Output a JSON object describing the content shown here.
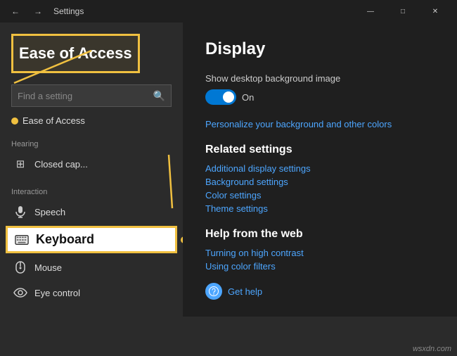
{
  "titleBar": {
    "title": "Settings",
    "backLabel": "←",
    "forwardLabel": "→",
    "minimizeLabel": "—",
    "maximizeLabel": "□",
    "closeLabel": "✕"
  },
  "sidebar": {
    "title": "Ease of Access",
    "search": {
      "placeholder": "Find a setting"
    },
    "breadcrumb": "Ease of Access",
    "sections": [
      {
        "label": "Hearing",
        "items": [
          {
            "id": "closed-captions",
            "text": "Closed cap...",
            "icon": "⊞"
          }
        ]
      },
      {
        "label": "Interaction",
        "items": [
          {
            "id": "speech",
            "text": "Speech",
            "icon": "🎤"
          },
          {
            "id": "keyboard",
            "text": "Keyboard",
            "icon": "⌨"
          },
          {
            "id": "mouse",
            "text": "Mouse",
            "icon": "🖱"
          },
          {
            "id": "eye-control",
            "text": "Eye control",
            "icon": "👁"
          }
        ]
      }
    ]
  },
  "main": {
    "title": "Display",
    "settings": [
      {
        "label": "Show desktop background image",
        "toggle": "on",
        "toggleText": "On"
      }
    ],
    "backgroundLink": "Personalize your background and other colors",
    "relatedSettings": {
      "heading": "Related settings",
      "links": [
        "Additional display settings",
        "Background settings",
        "Color settings",
        "Theme settings"
      ]
    },
    "helpFromWeb": {
      "heading": "Help from the web",
      "links": [
        "Turning on high contrast",
        "Using color filters"
      ]
    },
    "getHelp": {
      "label": "Get help",
      "icon": "💬"
    }
  },
  "watermark": "wsxdn.com"
}
